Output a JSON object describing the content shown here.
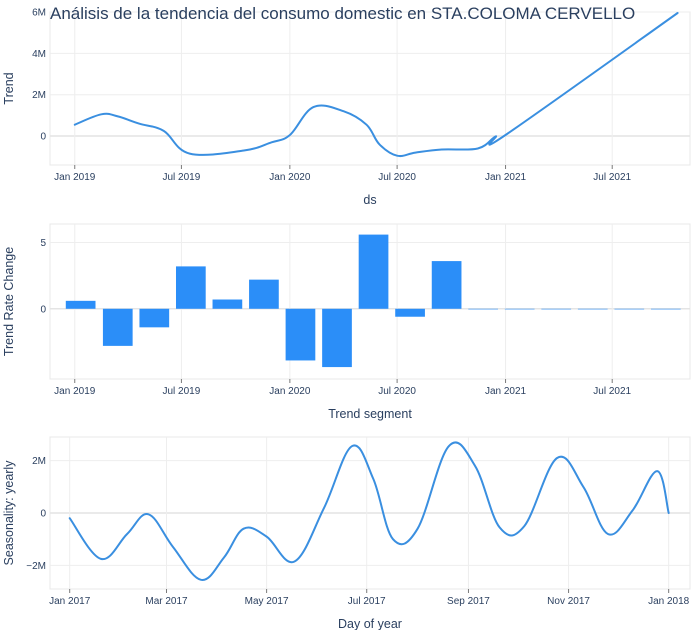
{
  "title": "Análisis de la tendencia del consumo domestic en STA.COLOMA CERVELLO",
  "colors": {
    "line": "#3a8fe0",
    "bar": "#2b8ef8",
    "text": "#2a3f5f"
  },
  "chart_data": [
    {
      "type": "line",
      "xlabel": "ds",
      "ylabel": "Trend",
      "x_ticks": [
        "Jan 2019",
        "Jul 2019",
        "Jan 2020",
        "Jul 2020",
        "Jan 2021",
        "Jul 2021"
      ],
      "y_ticks": [
        "0",
        "2M",
        "4M",
        "6M"
      ],
      "x_range": [
        "2018-11-20",
        "2021-11-10"
      ],
      "y_range": [
        -1400000,
        6000000
      ],
      "series": [
        {
          "x": [
            "2019-01-01",
            "2019-02-15",
            "2019-03-15",
            "2019-04-20",
            "2019-06-01",
            "2019-07-15",
            "2019-10-15",
            "2019-12-01",
            "2020-01-01",
            "2020-02-10",
            "2020-04-01",
            "2020-05-10",
            "2020-06-01",
            "2020-07-01",
            "2020-08-01",
            "2020-09-15",
            "2020-11-15",
            "2020-12-15",
            "2021-01-01",
            "2021-10-20"
          ],
          "y": [
            550000,
            1050000,
            950000,
            600000,
            250000,
            -850000,
            -700000,
            -300000,
            50000,
            1400000,
            1200000,
            550000,
            -400000,
            -950000,
            -800000,
            -650000,
            -600000,
            -20000,
            50000,
            5950000
          ]
        }
      ]
    },
    {
      "type": "bar",
      "xlabel": "Trend segment",
      "ylabel": "Trend Rate Change",
      "x_ticks": [
        "Jan 2019",
        "Jul 2019",
        "Jan 2020",
        "Jul 2020",
        "Jan 2021",
        "Jul 2021"
      ],
      "y_ticks": [
        "0",
        "5"
      ],
      "x_range": [
        "2018-11-20",
        "2021-11-10"
      ],
      "y_range": [
        -5.3,
        6.4
      ],
      "series": [
        {
          "x": [
            "2019-01-11",
            "2019-03-15",
            "2019-05-16",
            "2019-07-17",
            "2019-09-17",
            "2019-11-18",
            "2020-01-19",
            "2020-03-21",
            "2020-05-22",
            "2020-07-23",
            "2020-09-23",
            "2020-11-24",
            "2021-01-25",
            "2021-03-28",
            "2021-05-29",
            "2021-07-30",
            "2021-09-30"
          ],
          "y": [
            0.6,
            -2.8,
            -1.4,
            3.2,
            0.7,
            2.2,
            -3.9,
            -4.4,
            5.6,
            -0.6,
            3.6,
            0,
            0,
            0,
            0,
            0,
            0
          ]
        }
      ]
    },
    {
      "type": "line",
      "xlabel": "Day of year",
      "ylabel": "Seasonality: yearly",
      "x_ticks": [
        "Jan 2017",
        "Mar 2017",
        "May 2017",
        "Jul 2017",
        "Sep 2017",
        "Nov 2017",
        "Jan 2018"
      ],
      "y_ticks": [
        "−2M",
        "0",
        "2M"
      ],
      "x_range": [
        "2016-12-20",
        "2018-01-14"
      ],
      "y_range": [
        -2900000,
        2900000
      ],
      "series": [
        {
          "x": [
            "2017-01-01",
            "2017-01-20",
            "2017-02-05",
            "2017-02-18",
            "2017-03-05",
            "2017-03-22",
            "2017-04-05",
            "2017-04-17",
            "2017-05-01",
            "2017-05-18",
            "2017-06-05",
            "2017-06-22",
            "2017-07-05",
            "2017-07-17",
            "2017-08-01",
            "2017-08-20",
            "2017-09-05",
            "2017-09-20",
            "2017-10-05",
            "2017-10-25",
            "2017-11-10",
            "2017-11-25",
            "2017-12-10",
            "2017-12-25",
            "2018-01-01"
          ],
          "y": [
            -200000,
            -1750000,
            -800000,
            -50000,
            -1300000,
            -2550000,
            -1700000,
            -600000,
            -900000,
            -1850000,
            200000,
            2550000,
            1300000,
            -1000000,
            -600000,
            2550000,
            1800000,
            -550000,
            -500000,
            2100000,
            1000000,
            -800000,
            100000,
            1600000,
            0
          ]
        }
      ]
    }
  ]
}
